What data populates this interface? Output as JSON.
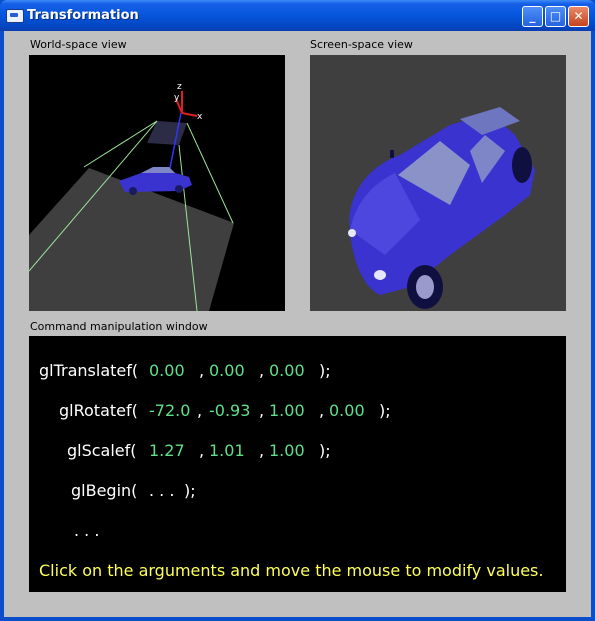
{
  "window": {
    "title": "Transformation",
    "buttons": {
      "minimize": "_",
      "maximize": "□",
      "close": "✕"
    }
  },
  "views": {
    "world_label": "World-space view",
    "screen_label": "Screen-space view",
    "axis_labels": {
      "x": "x",
      "y": "y",
      "z": "z"
    }
  },
  "command": {
    "label": "Command manipulation window",
    "translate": {
      "fn": "glTranslatef(",
      "args": [
        "0.00",
        "0.00",
        "0.00"
      ],
      "end": ");"
    },
    "rotate": {
      "fn": "glRotatef(",
      "args": [
        "-72.0",
        "-0.93",
        "1.00",
        "0.00"
      ],
      "end": ");"
    },
    "scale": {
      "fn": "glScalef(",
      "args": [
        "1.27",
        "1.01",
        "1.00"
      ],
      "end": ");"
    },
    "begin": {
      "fn": "glBegin(",
      "args_text": ". . .",
      "end": ");"
    },
    "ellipsis": ". . .",
    "comma": ",",
    "hint": "Click on the arguments and move the mouse to modify values."
  },
  "colors": {
    "titlebar": "#0655DA",
    "arg_value": "#5fe08a",
    "hint_text": "#ffff5a",
    "car": "#3a33d0"
  }
}
